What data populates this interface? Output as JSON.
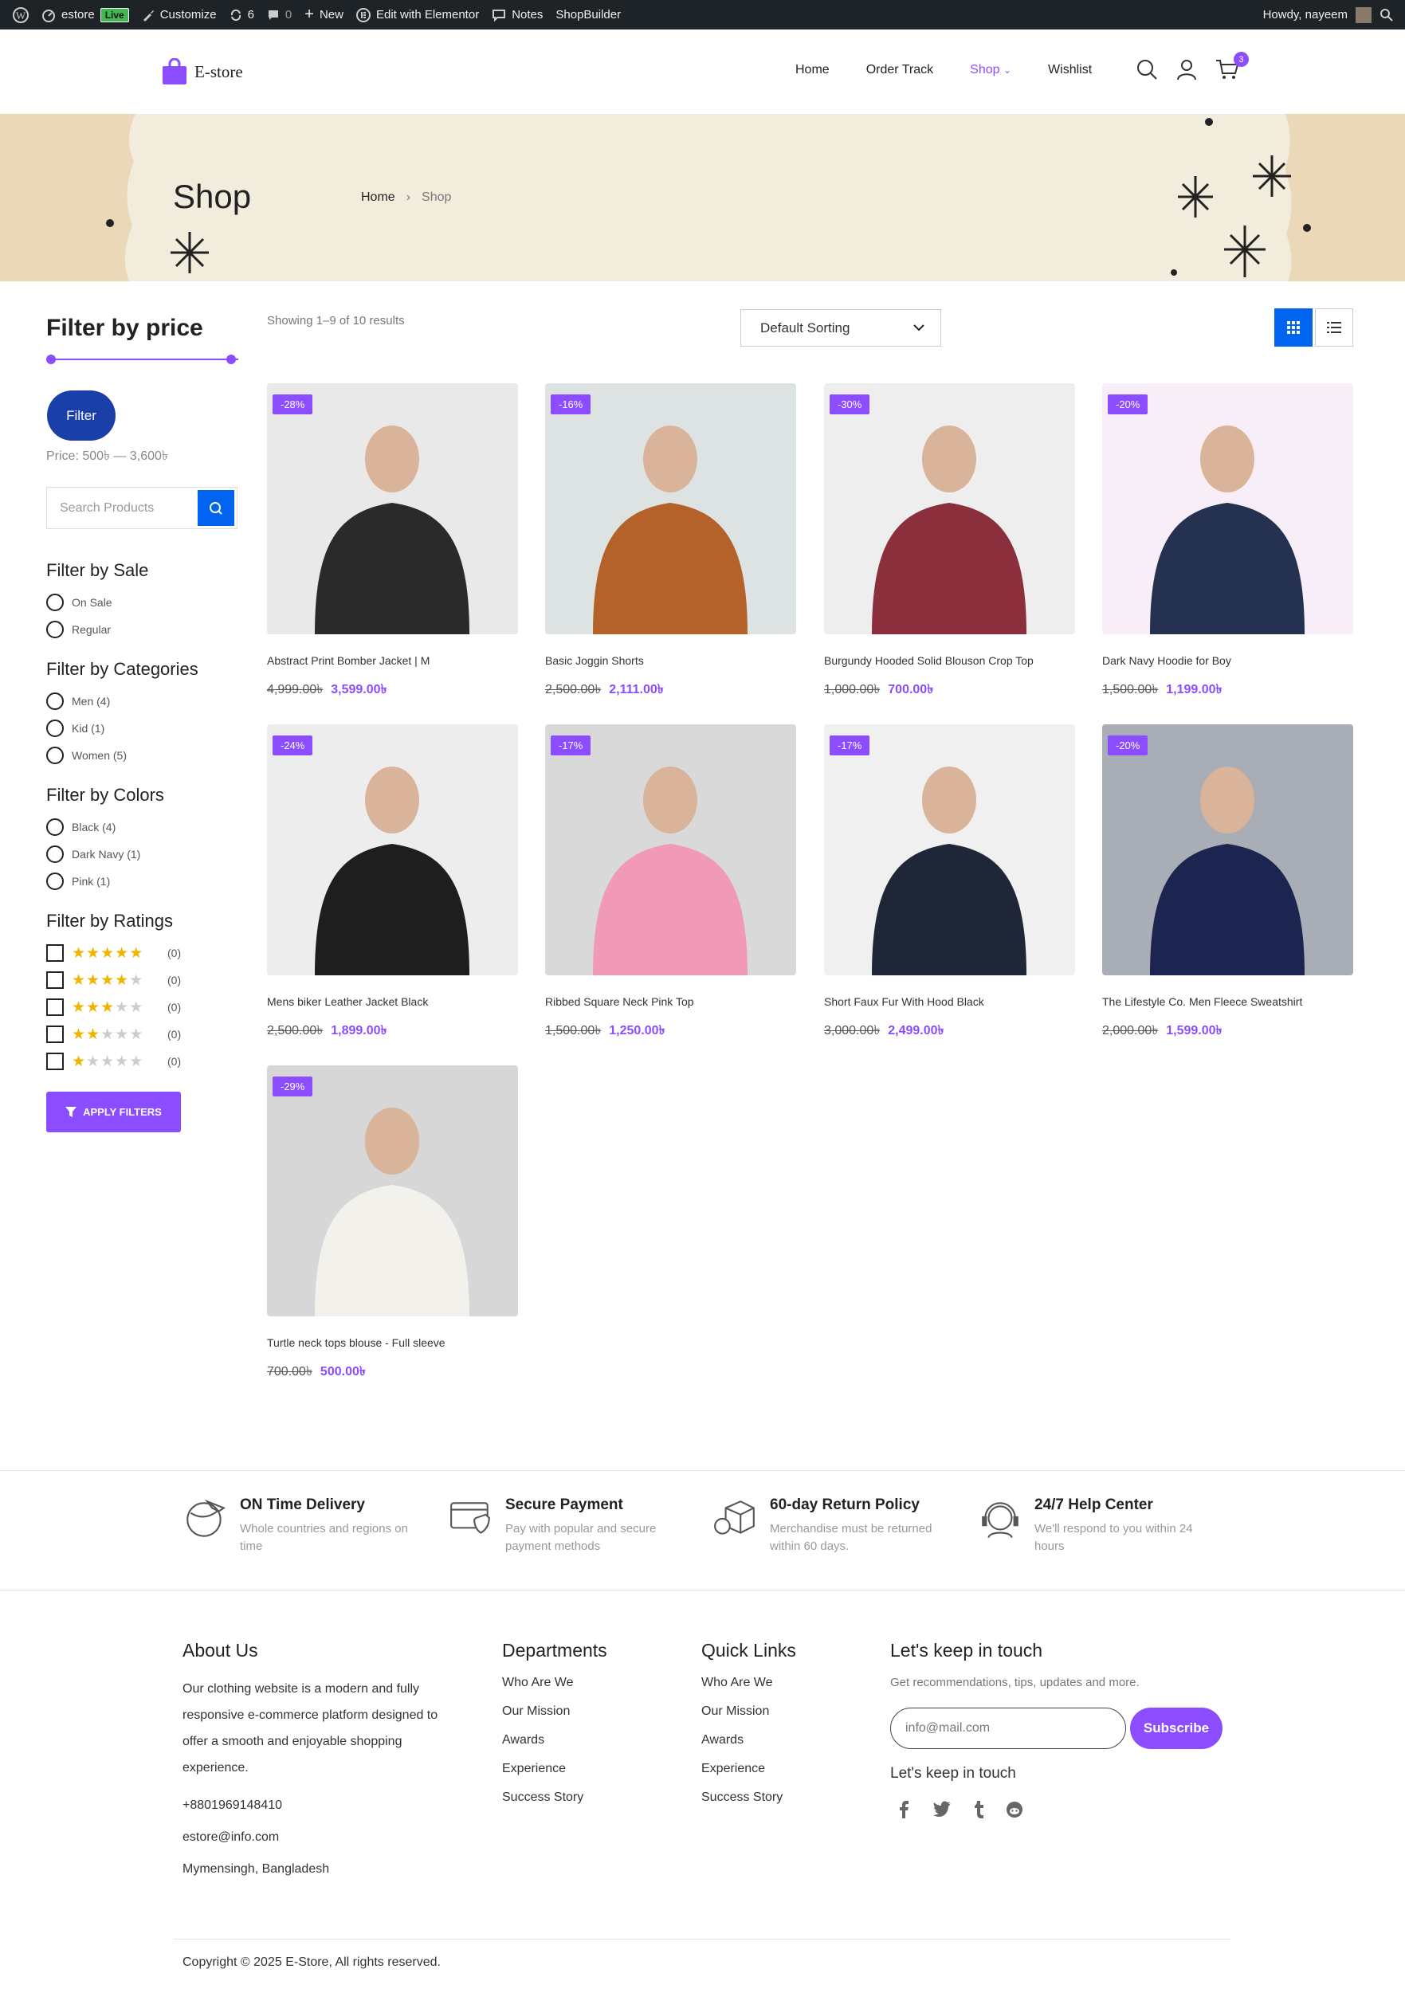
{
  "adminbar": {
    "site": "estore",
    "live": "Live",
    "customize": "Customize",
    "updates": "6",
    "comments": "0",
    "new": "New",
    "elementor": "Edit with Elementor",
    "notes": "Notes",
    "shopbuilder": "ShopBuilder",
    "greeting": "Howdy, nayeem"
  },
  "header": {
    "logo": "E-store",
    "nav": [
      "Home",
      "Order Track",
      "Shop",
      "Wishlist"
    ],
    "cart_count": "3"
  },
  "hero": {
    "title": "Shop",
    "crumb_home": "Home",
    "crumb_current": "Shop"
  },
  "sidebar": {
    "price_title": "Filter by price",
    "price_range": {
      "min": 500,
      "max": 3600
    },
    "filter_btn": "Filter",
    "price_text": "Price: 500৳ — 3,600৳",
    "search_placeholder": "Search Products",
    "sale_title": "Filter by Sale",
    "sale": [
      "On Sale",
      "Regular"
    ],
    "cat_title": "Filter by Categories",
    "categories": [
      "Men (4)",
      "Kid (1)",
      "Women (5)"
    ],
    "colors_title": "Filter by Colors",
    "colors": [
      "Black (4)",
      "Dark Navy (1)",
      "Pink (1)"
    ],
    "ratings_title": "Filter by Ratings",
    "ratings": [
      {
        "stars": 5,
        "count": "(0)"
      },
      {
        "stars": 4,
        "count": "(0)"
      },
      {
        "stars": 3,
        "count": "(0)"
      },
      {
        "stars": 2,
        "count": "(0)"
      },
      {
        "stars": 1,
        "count": "(0)"
      }
    ],
    "apply": "APPLY FILTERS"
  },
  "toolbar": {
    "showing": "Showing 1–9 of 10 results",
    "sort": "Default Sorting"
  },
  "products": [
    {
      "name": "Abstract Print Bomber Jacket | M",
      "old": "4,999.00৳",
      "new": "3,599.00৳",
      "badge": "-28%",
      "bg": "#e9e9e9",
      "fig": "#2a2a2a"
    },
    {
      "name": "Basic Joggin Shorts",
      "old": "2,500.00৳",
      "new": "2,111.00৳",
      "badge": "-16%",
      "bg": "#dde3e3",
      "fig": "#b4622a"
    },
    {
      "name": "Burgundy Hooded Solid Blouson Crop Top",
      "old": "1,000.00৳",
      "new": "700.00৳",
      "badge": "-30%",
      "bg": "#eeeeee",
      "fig": "#8b2f3c"
    },
    {
      "name": "Dark Navy Hoodie for Boy",
      "old": "1,500.00৳",
      "new": "1,199.00৳",
      "badge": "-20%",
      "bg": "#f7eef8",
      "fig": "#243150"
    },
    {
      "name": "Mens biker Leather Jacket Black",
      "old": "2,500.00৳",
      "new": "1,899.00৳",
      "badge": "-24%",
      "bg": "#ededed",
      "fig": "#1e1e1e"
    },
    {
      "name": "Ribbed Square Neck Pink Top",
      "old": "1,500.00৳",
      "new": "1,250.00৳",
      "badge": "-17%",
      "bg": "#d9d9d9",
      "fig": "#f19ab8"
    },
    {
      "name": "Short Faux Fur With Hood Black",
      "old": "3,000.00৳",
      "new": "2,499.00৳",
      "badge": "-17%",
      "bg": "#f0f0f0",
      "fig": "#1f2638"
    },
    {
      "name": "The Lifestyle Co. Men Fleece Sweatshirt",
      "old": "2,000.00৳",
      "new": "1,599.00৳",
      "badge": "-20%",
      "bg": "#a9aeb6",
      "fig": "#1c2450"
    },
    {
      "name": "Turtle neck tops blouse - Full sleeve",
      "old": "700.00৳",
      "new": "500.00৳",
      "badge": "-29%",
      "bg": "#d7d7d7",
      "fig": "#f3f1ec"
    }
  ],
  "features": [
    {
      "title": "ON Time Delivery",
      "desc": "Whole countries and regions on time",
      "icon": "globe-plane-icon"
    },
    {
      "title": "Secure Payment",
      "desc": "Pay with popular and secure payment methods",
      "icon": "card-shield-icon"
    },
    {
      "title": "60-day Return Policy",
      "desc": "Merchandise must be returned within 60 days.",
      "icon": "box-return-icon"
    },
    {
      "title": "24/7 Help Center",
      "desc": "We'll respond to you within 24 hours",
      "icon": "headset-icon"
    }
  ],
  "footer": {
    "about_title": "About Us",
    "about": "Our clothing website is a modern and fully responsive e-commerce platform designed to offer a smooth and enjoyable shopping experience.",
    "phone": "+8801969148410",
    "email": "estore@info.com",
    "address": "Mymensingh, Bangladesh",
    "dept_title": "Departments",
    "dept": [
      "Who Are We",
      "Our Mission",
      "Awards",
      "Experience",
      "Success Story"
    ],
    "quick_title": "Quick Links",
    "quick": [
      "Who Are We",
      "Our Mission",
      "Awards",
      "Experience",
      "Success Story"
    ],
    "touch_title": "Let's keep in touch",
    "touch_desc": "Get recommendations, tips, updates and more.",
    "email_placeholder": "info@mail.com",
    "subscribe": "Subscribe",
    "touch_title2": "Let's keep in touch",
    "copyright": "Copyright © 2025 E-Store, All rights reserved."
  },
  "colors": {
    "accent": "#8b4dff",
    "blue": "#0064f0",
    "navy": "#1a3fa8",
    "star": "#f0b400"
  }
}
